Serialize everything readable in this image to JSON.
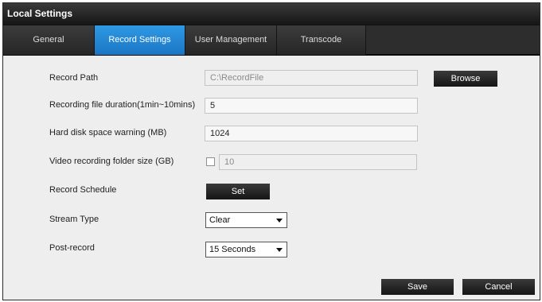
{
  "window": {
    "title": "Local Settings"
  },
  "tabs": [
    {
      "label": "General",
      "active": false
    },
    {
      "label": "Record Settings",
      "active": true
    },
    {
      "label": "User Management",
      "active": false
    },
    {
      "label": "Transcode",
      "active": false
    }
  ],
  "form": {
    "record_path": {
      "label": "Record Path",
      "value": "C:\\RecordFile",
      "button": "Browse"
    },
    "file_duration": {
      "label": "Recording file duration(1min~10mins)",
      "value": "5"
    },
    "disk_warning": {
      "label": "Hard disk space warning (MB)",
      "value": "1024"
    },
    "folder_size": {
      "label": "Video recording folder size (GB)",
      "checked": false,
      "value": "10"
    },
    "schedule": {
      "label": "Record Schedule",
      "button": "Set"
    },
    "stream_type": {
      "label": "Stream Type",
      "selected": "Clear"
    },
    "post_record": {
      "label": "Post-record",
      "selected": "15 Seconds"
    }
  },
  "footer": {
    "save": "Save",
    "cancel": "Cancel"
  },
  "colors": {
    "accent": "#2388d6",
    "dark": "#1f1f1f"
  }
}
